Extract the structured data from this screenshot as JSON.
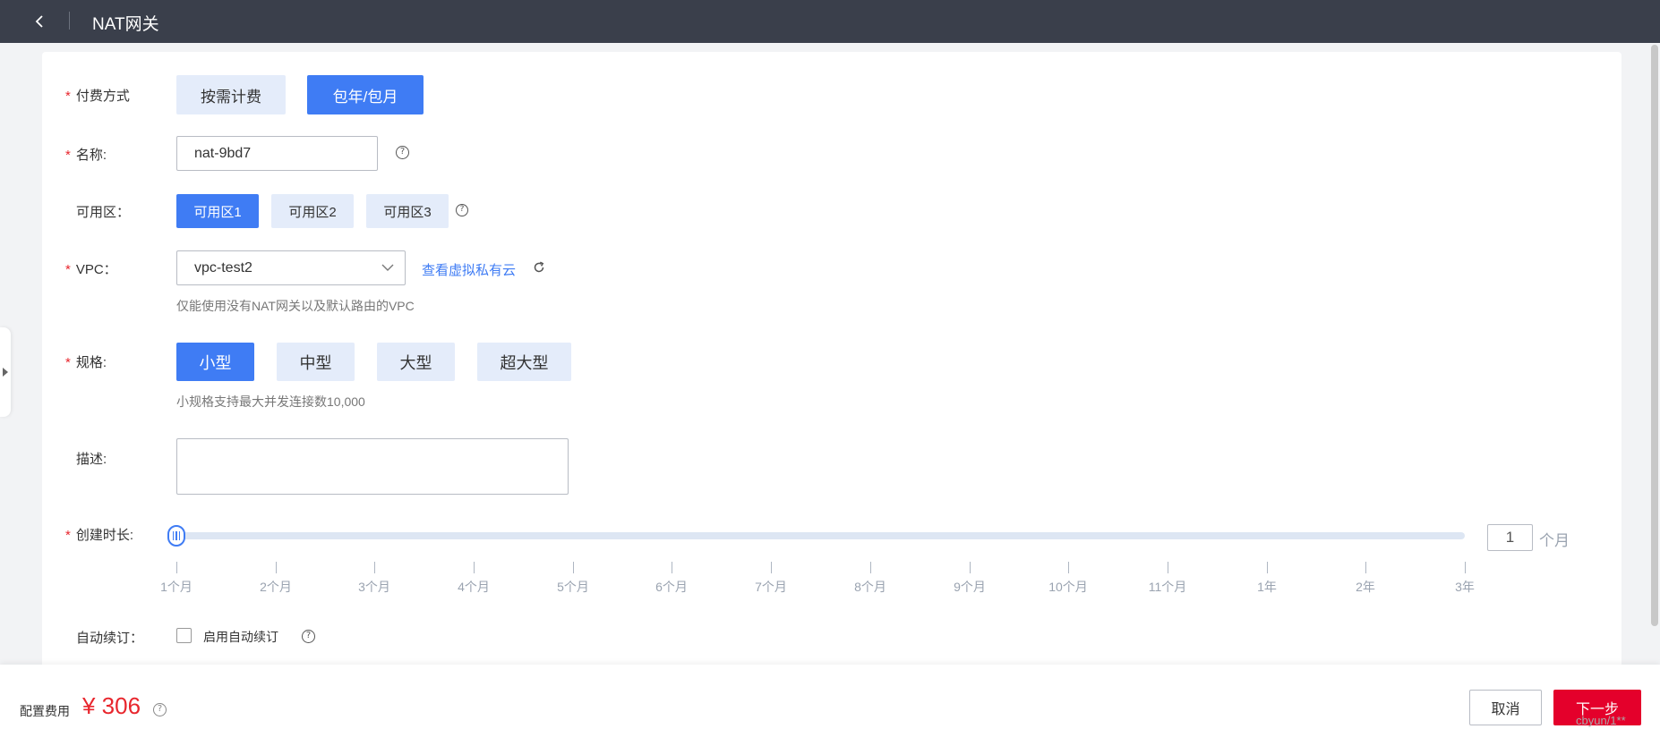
{
  "header": {
    "back_icon": "chevron-left-icon",
    "title": "NAT网关"
  },
  "form": {
    "billing": {
      "label": "付费方式",
      "options": [
        {
          "label": "按需计费",
          "selected": false
        },
        {
          "label": "包年/包月",
          "selected": true
        }
      ]
    },
    "name": {
      "label": "名称:",
      "value": "nat-9bd7"
    },
    "zone": {
      "label": "可用区：",
      "options": [
        {
          "label": "可用区1",
          "selected": true
        },
        {
          "label": "可用区2",
          "selected": false
        },
        {
          "label": "可用区3",
          "selected": false
        }
      ]
    },
    "vpc": {
      "label": "VPC：",
      "selected": "vpc-test2",
      "link": "查看虚拟私有云",
      "hint": "仅能使用没有NAT网关以及默认路由的VPC"
    },
    "spec": {
      "label": "规格:",
      "options": [
        {
          "label": "小型",
          "selected": true
        },
        {
          "label": "中型",
          "selected": false
        },
        {
          "label": "大型",
          "selected": false
        },
        {
          "label": "超大型",
          "selected": false
        }
      ],
      "hint": "小规格支持最大并发连接数10,000"
    },
    "description": {
      "label": "描述:",
      "value": ""
    },
    "duration": {
      "label": "创建时长:",
      "ticks": [
        "1个月",
        "2个月",
        "3个月",
        "4个月",
        "5个月",
        "6个月",
        "7个月",
        "8个月",
        "9个月",
        "10个月",
        "11个月",
        "1年",
        "2年",
        "3年"
      ],
      "selected_index": 0,
      "value": "1",
      "unit": "个月"
    },
    "auto_renew": {
      "label": "自动续订：",
      "checkbox_label": "启用自动续订",
      "checked": false
    }
  },
  "footer": {
    "fee_label": "配置费用",
    "fee_value": "¥ 306",
    "cancel_label": "取消",
    "next_label": "下一步",
    "watermark": "cbyun/1**"
  },
  "colors": {
    "accent": "#3f7cf4",
    "danger": "#e4002b",
    "topbar": "#3a3f4b"
  }
}
